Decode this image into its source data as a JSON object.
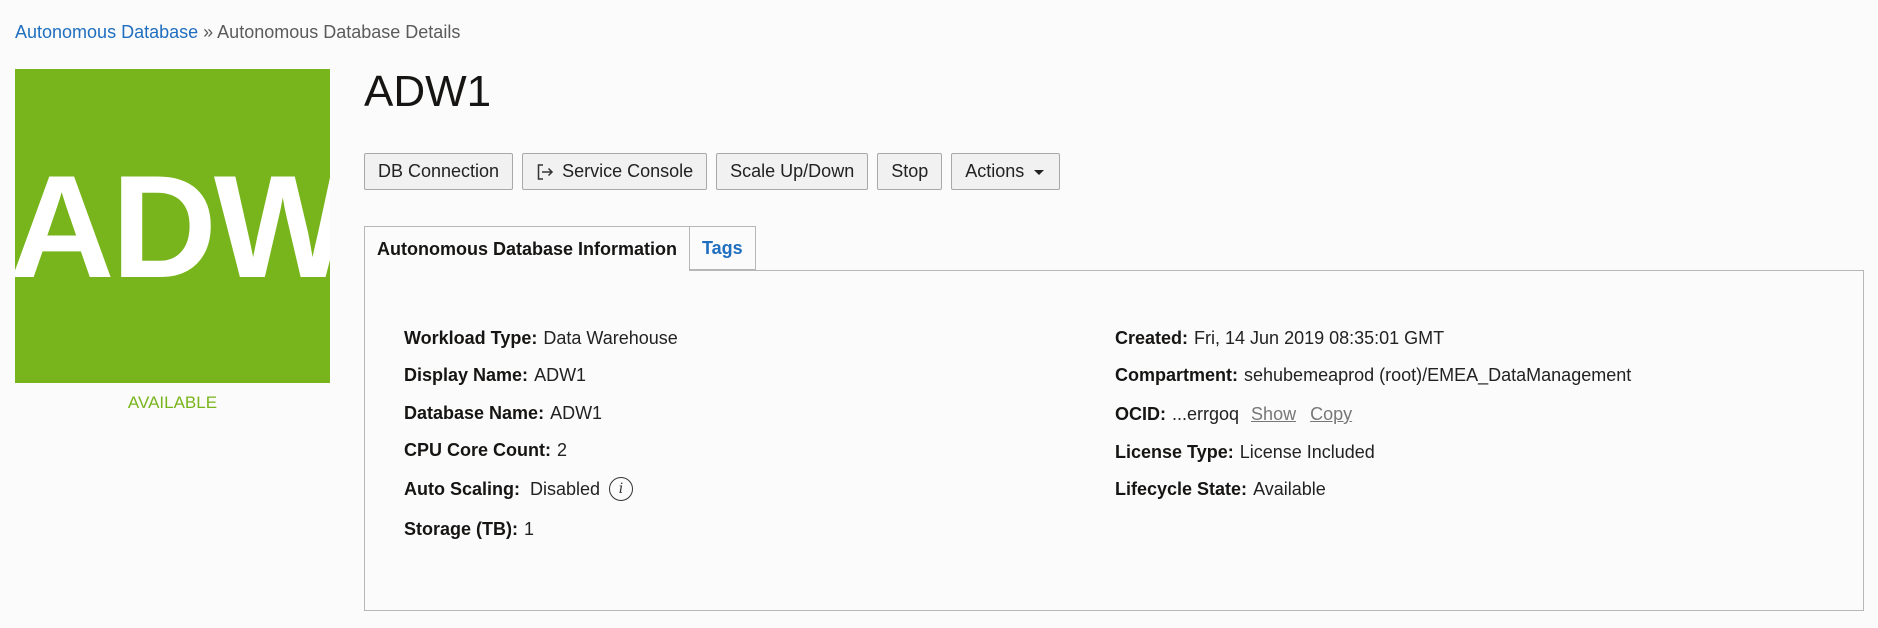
{
  "breadcrumb": {
    "parent": "Autonomous Database",
    "separator": "»",
    "current": "Autonomous Database Details"
  },
  "logo": {
    "text": "ADW",
    "color": "#78b51c"
  },
  "status": {
    "text": "AVAILABLE",
    "color": "#78b51c"
  },
  "title": "ADW1",
  "toolbar": {
    "db_connection": "DB Connection",
    "service_console": "Service Console",
    "scale": "Scale Up/Down",
    "stop": "Stop",
    "actions": "Actions"
  },
  "tabs": [
    {
      "label": "Autonomous Database Information",
      "active": true
    },
    {
      "label": "Tags",
      "active": false
    }
  ],
  "info_left": {
    "workload_type": {
      "label": "Workload Type:",
      "value": "Data Warehouse"
    },
    "display_name": {
      "label": "Display Name:",
      "value": "ADW1"
    },
    "database_name": {
      "label": "Database Name:",
      "value": "ADW1"
    },
    "cpu_core_count": {
      "label": "CPU Core Count:",
      "value": "2"
    },
    "auto_scaling": {
      "label": "Auto Scaling:",
      "value": "Disabled",
      "icon": "info-icon"
    },
    "storage": {
      "label": "Storage (TB):",
      "value": "1"
    }
  },
  "info_right": {
    "created": {
      "label": "Created:",
      "value": "Fri, 14 Jun 2019 08:35:01 GMT"
    },
    "compartment": {
      "label": "Compartment:",
      "value": "sehubemeaprod (root)/EMEA_DataManagement"
    },
    "ocid": {
      "label": "OCID:",
      "value": "...errgoq",
      "show": "Show",
      "copy": "Copy"
    },
    "license_type": {
      "label": "License Type:",
      "value": "License Included"
    },
    "lifecycle_state": {
      "label": "Lifecycle State:",
      "value": "Available"
    }
  },
  "colors": {
    "link": "#1f6ebf",
    "accent_green": "#78b51c"
  }
}
